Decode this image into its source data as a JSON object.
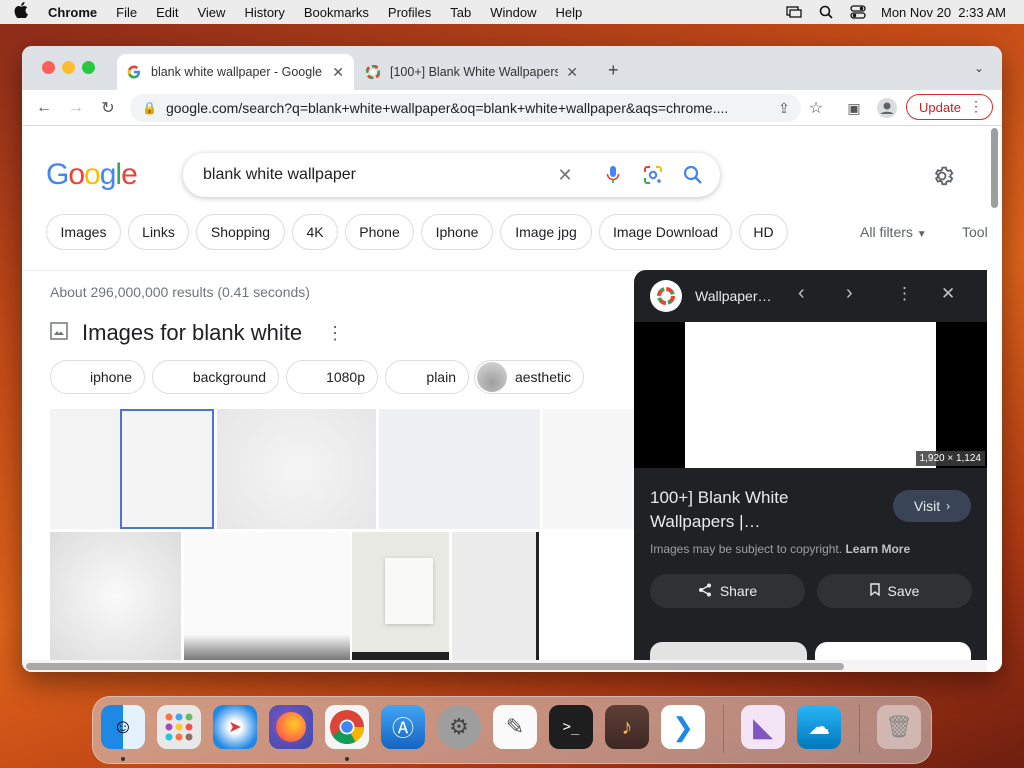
{
  "menubar": {
    "app": "Chrome",
    "items": [
      "File",
      "Edit",
      "View",
      "History",
      "Bookmarks",
      "Profiles",
      "Tab",
      "Window",
      "Help"
    ],
    "datetime": "Mon Nov 20  2:33 AM"
  },
  "tabs": [
    {
      "title": "blank white wallpaper - Google Search",
      "favicon": "google-g-icon"
    },
    {
      "title": "[100+] Blank White Wallpapers",
      "favicon": "wallpaper-site-icon"
    }
  ],
  "toolbar": {
    "url": "google.com/search?q=blank+white+wallpaper&oq=blank+white+wallpaper&aqs=chrome....",
    "update_label": "Update"
  },
  "google": {
    "logo": "Google",
    "query": "blank white wallpaper",
    "chips": [
      "Images",
      "Links",
      "Shopping",
      "4K",
      "Phone",
      "Iphone",
      "Image jpg",
      "Image Download",
      "HD"
    ],
    "all_filters": "All filters",
    "tools": "Tool",
    "stats": "About 296,000,000 results (0.41 seconds)",
    "images_heading": "Images for blank white",
    "related": [
      "iphone",
      "background",
      "1080p",
      "plain",
      "aesthetic"
    ]
  },
  "panel": {
    "site": "Wallpaper…",
    "dimensions": "1,920 × 1,124",
    "title": "100+] Blank White Wallpapers |…",
    "visit": "Visit",
    "copyright": "Images may be subject to copyright.",
    "learn_more": "Learn More",
    "share": "Share",
    "save": "Save"
  },
  "colors": {
    "accent_blue": "#1a73e8",
    "update_red": "#d93025",
    "panel_bg": "#202124"
  },
  "dock": [
    "Finder",
    "Launchpad",
    "Safari",
    "Firefox",
    "Chrome",
    "App Store",
    "System Preferences",
    "TextEdit",
    "Terminal",
    "GarageBand",
    "VS Code",
    "Visual Studio",
    "Weather",
    "Trash"
  ]
}
